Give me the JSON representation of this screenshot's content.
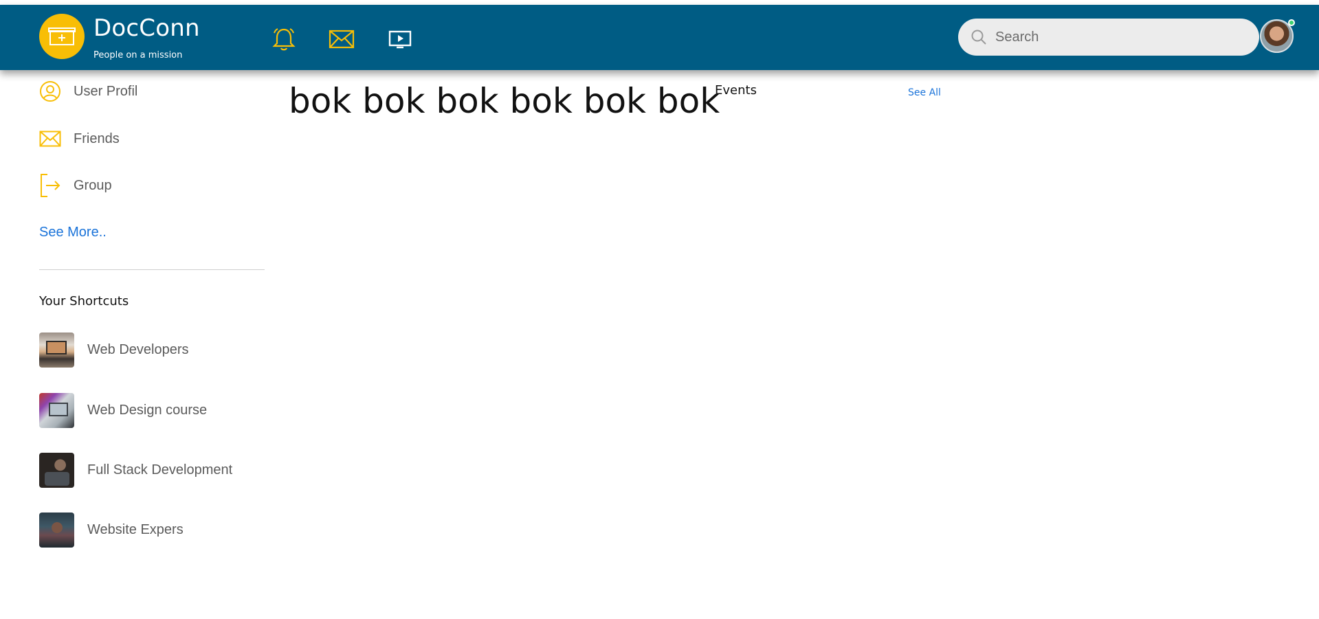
{
  "header": {
    "brand_name": "DocConn",
    "brand_tagline": "People on a mission",
    "search_placeholder": "Search",
    "icons": [
      "medical-kit-icon",
      "bell-icon",
      "envelope-icon",
      "video-play-icon",
      "search-icon"
    ],
    "colors": {
      "bar": "#005c84",
      "accent": "#f8be06",
      "link": "#1a73d9",
      "online": "#3bd16f"
    }
  },
  "sidebar": {
    "items": [
      {
        "label": "User Profil",
        "icon": "user-icon"
      },
      {
        "label": "Friends",
        "icon": "envelope-icon"
      },
      {
        "label": "Group",
        "icon": "logout-icon"
      }
    ],
    "see_more": "See More..",
    "shortcuts_title": "Your Shortcuts",
    "shortcuts": [
      {
        "label": "Web Developers"
      },
      {
        "label": "Web Design course"
      },
      {
        "label": "Full Stack Development"
      },
      {
        "label": "Website Expers"
      }
    ]
  },
  "main": {
    "headline": "bok bok bok bok bok bok",
    "events_title": "Events",
    "see_all": "See All"
  }
}
